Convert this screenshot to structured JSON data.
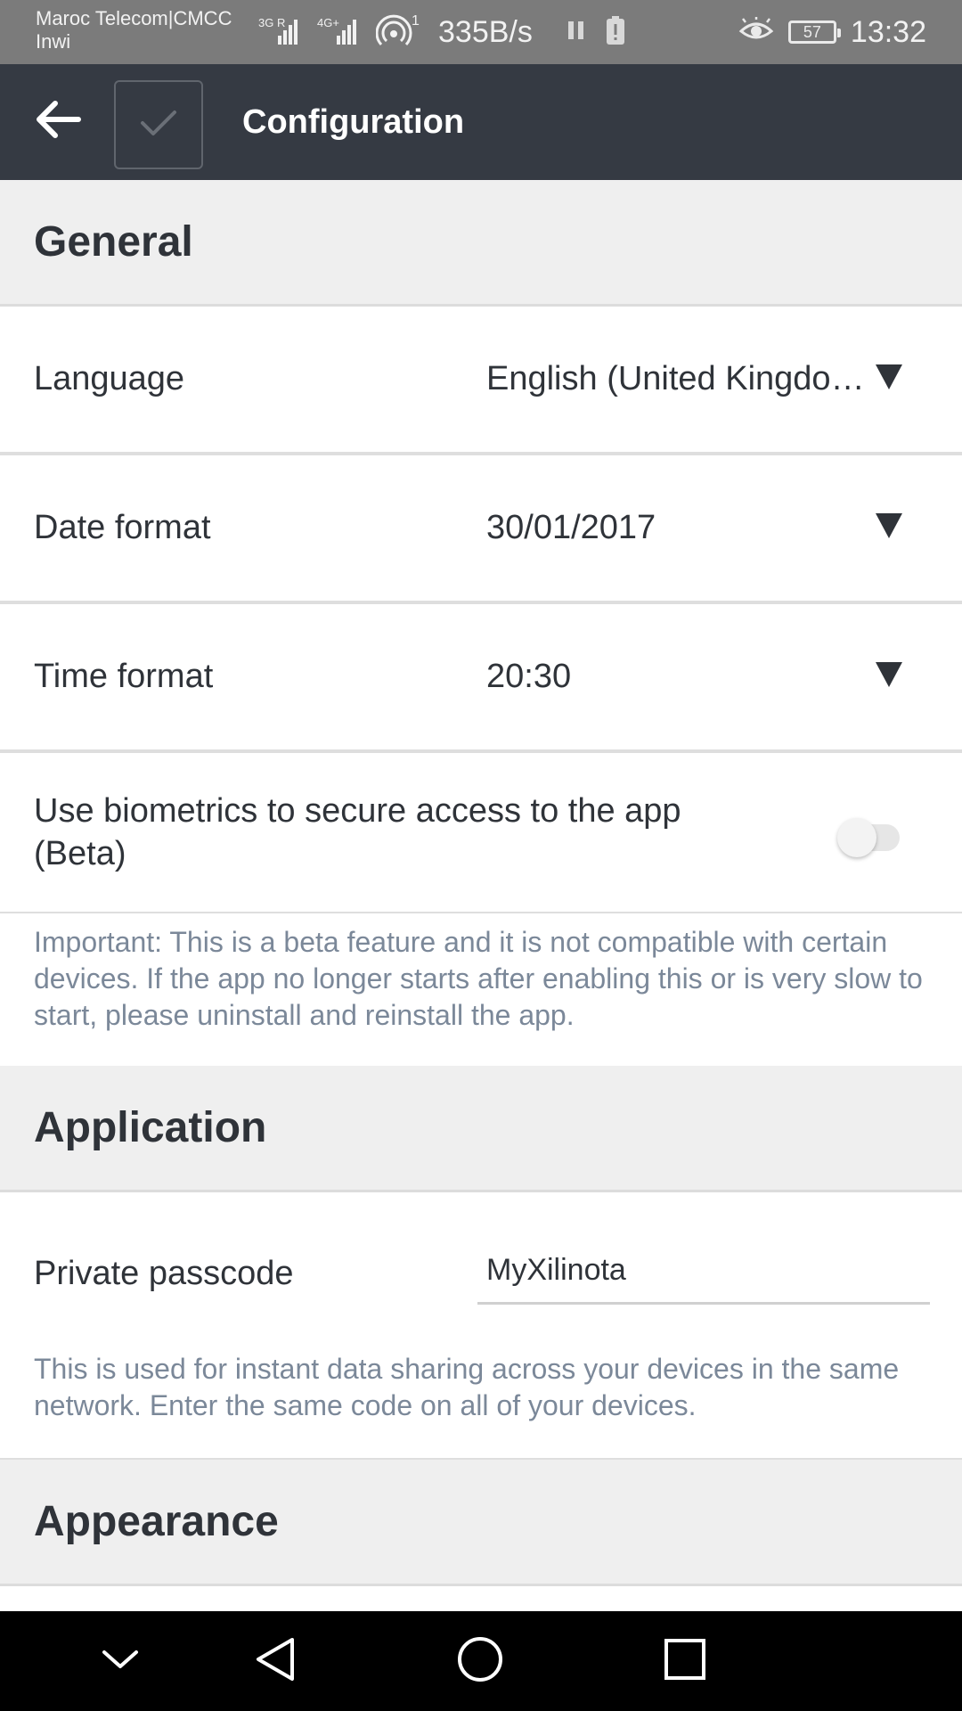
{
  "status_bar": {
    "carrier_line1": "Maroc Telecom|CMCC",
    "carrier_line2": "Inwi",
    "signal1_tag": "3G R",
    "signal2_tag": "4G+",
    "hotspot_count": "1",
    "net_speed": "335B/s",
    "battery_level": "57",
    "time": "13:32"
  },
  "app_bar": {
    "title": "Configuration"
  },
  "sections": {
    "general": "General",
    "application": "Application",
    "appearance": "Appearance"
  },
  "settings": {
    "language": {
      "label": "Language",
      "value": "English (United Kingdom)"
    },
    "date_format": {
      "label": "Date format",
      "value": "30/01/2017"
    },
    "time_format": {
      "label": "Time format",
      "value": "20:30"
    },
    "biometrics": {
      "label": "Use biometrics to secure access to the app (Beta)",
      "enabled": false,
      "note": "Important: This is a beta feature and it is not compatible with certain devices. If the app no longer starts after enabling this or is very slow to start, please uninstall and reinstall the app."
    },
    "passcode": {
      "label": "Private passcode",
      "value": "MyXilinota",
      "note": "This is used for instant data sharing across your devices in the same network. Enter the same code on all of your devices."
    }
  },
  "icons": {
    "back": "arrow-left",
    "save": "checkmark",
    "dropdown": "triangle-down",
    "nav_down": "chevron-down",
    "nav_back": "triangle-left",
    "nav_home": "circle",
    "nav_recents": "square"
  },
  "colors": {
    "app_bar": "#353a43",
    "status_bar": "#7b7b7b",
    "section_bg": "#efefef",
    "note_text": "#7b8899",
    "text": "#2f3339"
  }
}
